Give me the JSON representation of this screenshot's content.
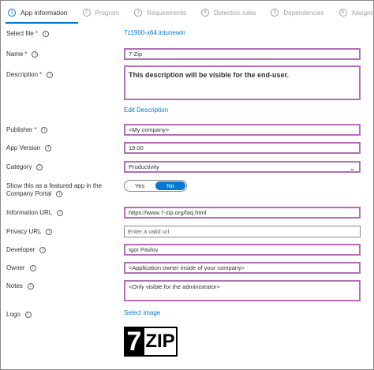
{
  "tabs": [
    {
      "num": "1",
      "label": "App information"
    },
    {
      "num": "2",
      "label": "Program"
    },
    {
      "num": "3",
      "label": "Requirements"
    },
    {
      "num": "4",
      "label": "Detection rules"
    },
    {
      "num": "5",
      "label": "Dependencies"
    },
    {
      "num": "6",
      "label": "Assignm"
    }
  ],
  "form": {
    "select_file": {
      "label": "Select file",
      "value": "7z1900-x64.intunewin"
    },
    "name": {
      "label": "Name",
      "value": "7-Zip"
    },
    "description": {
      "label": "Description",
      "value": "This description will be visible for the end-user.",
      "edit_link": "Edit Description"
    },
    "publisher": {
      "label": "Publisher",
      "value": "<My company>"
    },
    "app_version": {
      "label": "App Version",
      "value": "19.00"
    },
    "category": {
      "label": "Category",
      "value": "Productivity"
    },
    "featured": {
      "label_line1": "Show this as a featured app in the",
      "label_line2": "Company Portal",
      "yes": "Yes",
      "no": "No",
      "selected": "No"
    },
    "information_url": {
      "label": "Information URL",
      "value": "https://www.7-zip.org/faq.html"
    },
    "privacy_url": {
      "label": "Privacy URL",
      "placeholder": "Enter a valid url"
    },
    "developer": {
      "label": "Developer",
      "value": "Igor Pavlov"
    },
    "owner": {
      "label": "Owner",
      "value": "<Application owner inside of your company>"
    },
    "notes": {
      "label": "Notes",
      "value": "<Only visible for the administrator>"
    },
    "logo": {
      "label": "Logo",
      "select_link": "Select image",
      "logo_text": "7ZIP"
    }
  },
  "colors": {
    "accent": "#0078d4",
    "highlight_border": "#b46eb8",
    "required": "#a4262c"
  }
}
